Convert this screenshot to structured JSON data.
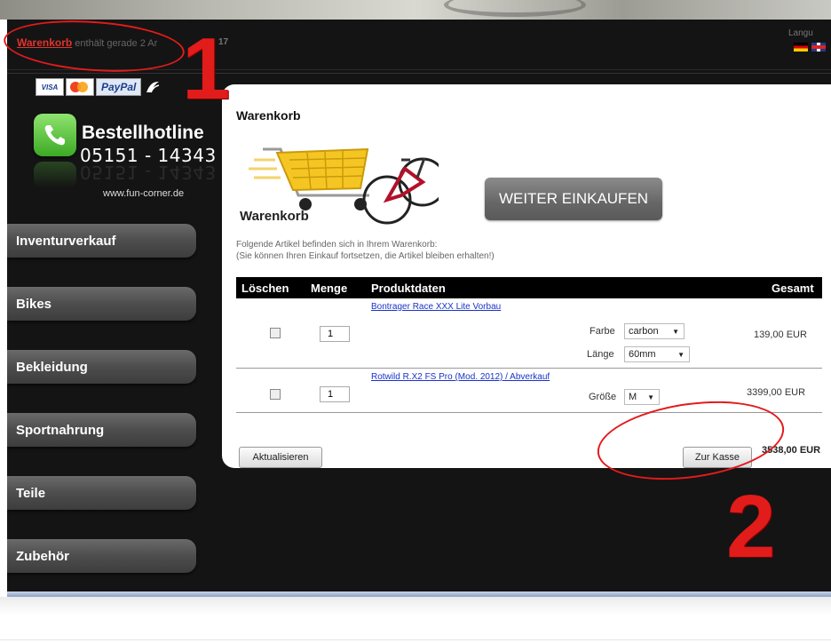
{
  "header": {
    "cart_link": "Warenkorb",
    "cart_status": "enthält gerade 2 Ar",
    "logo_fragment": "17",
    "language_label": "Langu"
  },
  "sidebar": {
    "payments": {
      "visa": "VISA",
      "paypal": "PayPal",
      "sofort_icon": "sofort-icon"
    },
    "hotline": {
      "title": "Bestellhotline",
      "number": "05151 - 14343",
      "icon": "phone-icon"
    },
    "website": "www.fun-corner.de",
    "nav": [
      {
        "label": "Inventurverkauf"
      },
      {
        "label": "Bikes"
      },
      {
        "label": "Bekleidung"
      },
      {
        "label": "Sportnahrung"
      },
      {
        "label": "Teile"
      },
      {
        "label": "Zubehör"
      }
    ]
  },
  "cart": {
    "title": "Warenkorb",
    "illustration_label": "Warenkorb",
    "continue_button": "WEITER EINKAUFEN",
    "info_line1": "Folgende Artikel befinden sich in Ihrem Warenkorb:",
    "info_line2": "(Sie können Ihren Einkauf fortsetzen, die Artikel bleiben erhalten!)",
    "columns": {
      "delete": "Löschen",
      "qty": "Menge",
      "product": "Produktdaten",
      "total": "Gesamt"
    },
    "items": [
      {
        "name": "Bontrager Race XXX Lite Vorbau",
        "qty": "1",
        "options": [
          {
            "label": "Farbe",
            "value": "carbon"
          },
          {
            "label": "Länge",
            "value": "60mm"
          }
        ],
        "price": "139,00 EUR"
      },
      {
        "name": "Rotwild R.X2 FS Pro (Mod. 2012) / Abverkauf",
        "qty": "1",
        "options": [
          {
            "label": "Größe",
            "value": "M"
          }
        ],
        "price": "3399,00 EUR"
      }
    ],
    "update_button": "Aktualisieren",
    "checkout_button": "Zur Kasse",
    "grand_total": "3538,00 EUR"
  },
  "annotations": {
    "step1": "1",
    "step2": "2",
    "color": "#e21b1b"
  }
}
